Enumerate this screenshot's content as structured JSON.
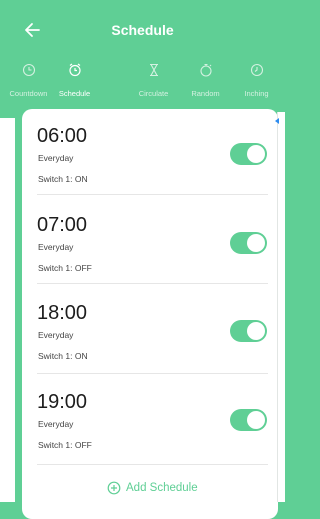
{
  "header": {
    "title": "Schedule"
  },
  "tabs": [
    {
      "label": "Countdown",
      "icon": "clock-icon",
      "active": false
    },
    {
      "label": "Schedule",
      "icon": "alarm-clock-icon",
      "active": true
    },
    {
      "label": "Circulate",
      "icon": "hourglass-icon",
      "active": false
    },
    {
      "label": "Random",
      "icon": "stopwatch-icon",
      "active": false
    },
    {
      "label": "Inching",
      "icon": "clock-icon",
      "active": false
    }
  ],
  "schedules": [
    {
      "time": "06:00",
      "repeat": "Everyday",
      "action": "Switch 1: ON",
      "enabled": true
    },
    {
      "time": "07:00",
      "repeat": "Everyday",
      "action": "Switch 1: OFF",
      "enabled": true
    },
    {
      "time": "18:00",
      "repeat": "Everyday",
      "action": "Switch 1: ON",
      "enabled": true
    },
    {
      "time": "19:00",
      "repeat": "Everyday",
      "action": "Switch 1: OFF",
      "enabled": true
    }
  ],
  "add_button": {
    "label": "Add Schedule",
    "icon": "plus-circle-icon"
  },
  "colors": {
    "accent": "#5fcf95",
    "text": "#1d1d1d",
    "secondary_text": "#444444",
    "scroll_marker": "#2e8cf0"
  }
}
